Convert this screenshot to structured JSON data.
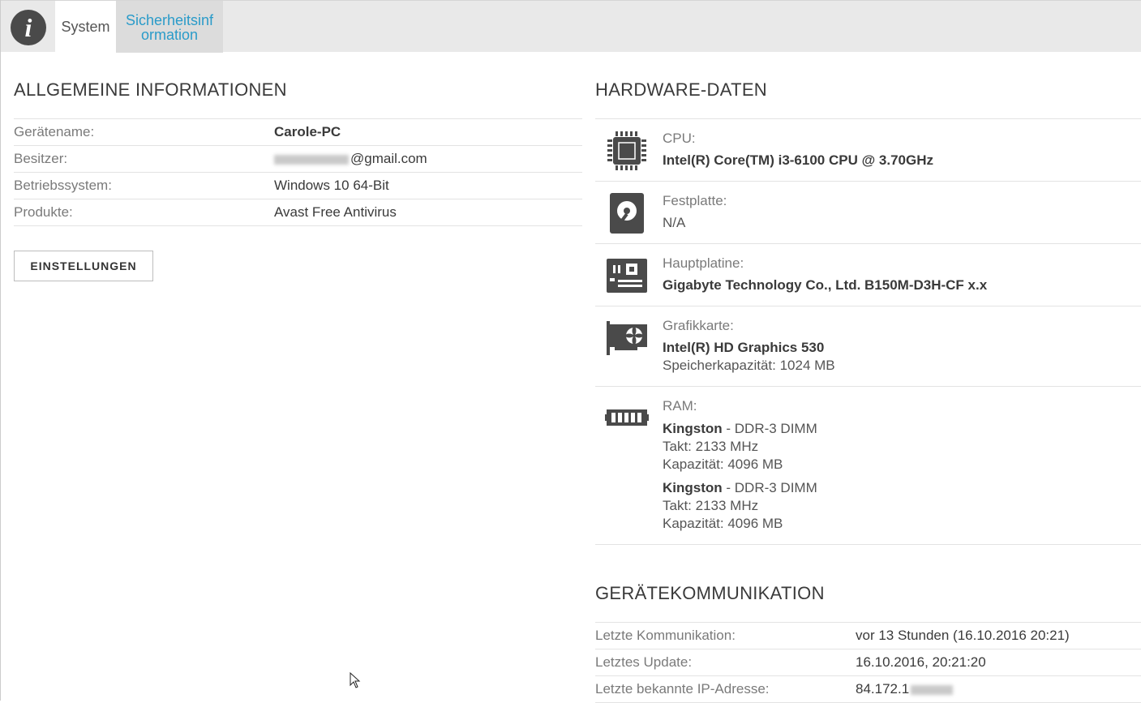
{
  "tabs": [
    {
      "label": "System"
    },
    {
      "label_line1": "Sicherheitsinf",
      "label_line2": "ormation"
    }
  ],
  "general": {
    "title": "ALLGEMEINE INFORMATIONEN",
    "rows": [
      {
        "key": "Gerätename:",
        "value": "Carole-PC"
      },
      {
        "key": "Besitzer:",
        "value": "@gmail.com"
      },
      {
        "key": "Betriebssystem:",
        "value": "Windows 10 64-Bit"
      },
      {
        "key": "Produkte:",
        "value": "Avast Free Antivirus"
      }
    ],
    "button_label": "EINSTELLUNGEN"
  },
  "hardware": {
    "title": "HARDWARE-DATEN",
    "cpu": {
      "label": "CPU:",
      "value": "Intel(R) Core(TM) i3-6100 CPU @ 3.70GHz",
      "icon": "cpu-icon"
    },
    "disk": {
      "label": "Festplatte:",
      "value": "N/A",
      "icon": "hard-disk-icon"
    },
    "board": {
      "label": "Hauptplatine:",
      "value": "Gigabyte Technology Co., Ltd. B150M-D3H-CF x.x",
      "icon": "motherboard-icon"
    },
    "gpu": {
      "label": "Grafikkarte:",
      "value": "Intel(R) HD Graphics 530",
      "memory": "Speicherkapazität: 1024 MB",
      "icon": "graphics-card-icon"
    },
    "ram": {
      "label": "RAM:",
      "icon": "ram-icon",
      "modules": [
        {
          "brand": "Kingston",
          "type": " - DDR-3 DIMM",
          "clock": "Takt: 2133 MHz",
          "capacity": "Kapazität: 4096 MB"
        },
        {
          "brand": "Kingston",
          "type": " - DDR-3 DIMM",
          "clock": "Takt: 2133 MHz",
          "capacity": "Kapazität: 4096 MB"
        }
      ]
    }
  },
  "communication": {
    "title": "GERÄTEKOMMUNIKATION",
    "rows": [
      {
        "key": "Letzte Kommunikation:",
        "value": "vor 13 Stunden (16.10.2016 20:21)"
      },
      {
        "key": "Letztes Update:",
        "value": "16.10.2016, 20:21:20"
      },
      {
        "key": "Letzte bekannte IP-Adresse:",
        "value": "84.172.1"
      }
    ]
  },
  "colors": {
    "accent": "#2a9bc9",
    "icon": "#4a4a4a",
    "topbar": "#e9e9e9"
  }
}
